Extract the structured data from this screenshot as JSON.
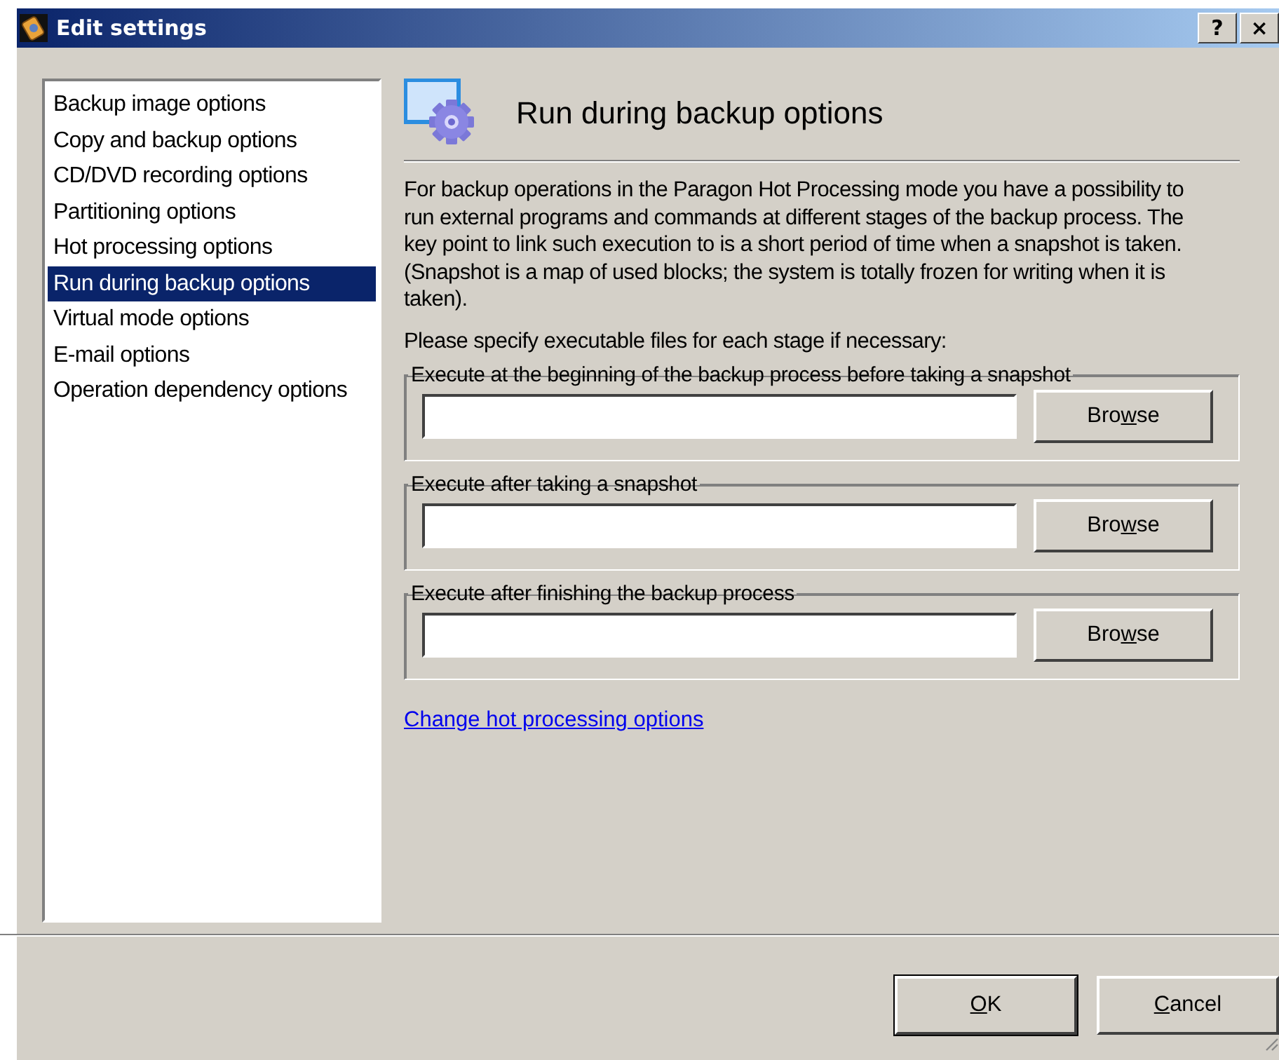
{
  "window": {
    "title": "Edit settings",
    "help": "?",
    "close": "×"
  },
  "sidebar": {
    "items": [
      {
        "label": "Backup image options",
        "selected": false
      },
      {
        "label": "Copy and backup options",
        "selected": false
      },
      {
        "label": "CD/DVD recording options",
        "selected": false
      },
      {
        "label": "Partitioning options",
        "selected": false
      },
      {
        "label": "Hot processing options",
        "selected": false
      },
      {
        "label": "Run during backup options",
        "selected": true
      },
      {
        "label": "Virtual mode options",
        "selected": false
      },
      {
        "label": "E-mail options",
        "selected": false
      },
      {
        "label": "Operation dependency options",
        "selected": false
      }
    ]
  },
  "page": {
    "title": "Run during backup options",
    "description": "For backup operations in the Paragon Hot Processing mode you have a possibility to run external programs and commands at different stages of the backup process. The key point to link such execution to is a short period of time when a snapshot is taken. (Snapshot is a map of used blocks; the system is totally frozen for writing when it is taken).",
    "prompt": "Please specify executable files for each stage if necessary:",
    "groups": [
      {
        "legend": "Execute at the beginning of the backup process before taking a snapshot",
        "button": [
          "Bro",
          "w",
          "se"
        ]
      },
      {
        "legend": "Execute after taking a snapshot",
        "button": [
          "Bro",
          "w",
          "se"
        ]
      },
      {
        "legend": "Execute after finishing the backup process",
        "button": [
          "Bro",
          "w",
          "se"
        ]
      }
    ],
    "link": "Change hot processing options"
  },
  "buttons": [
    {
      "key": "O",
      "after": "K"
    },
    {
      "key": "C",
      "after": "ancel"
    }
  ]
}
